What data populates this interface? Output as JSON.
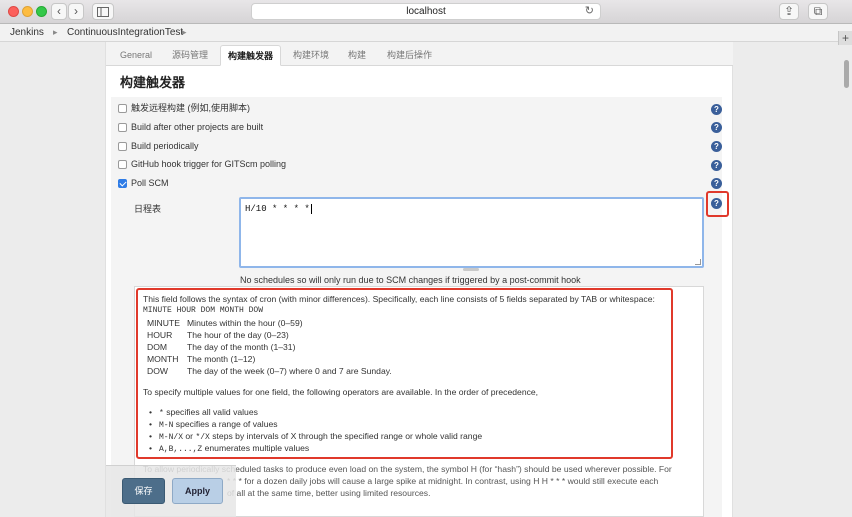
{
  "browser": {
    "url": "localhost",
    "back_glyph": "‹",
    "forward_glyph": "›",
    "reload_glyph": "↻",
    "share_glyph": "⇪",
    "tabs_glyph": "⧉",
    "newtab_glyph": "+"
  },
  "breadcrumb": {
    "items": [
      "Jenkins",
      "ContinuousIntegrationTest"
    ],
    "separator": "▸"
  },
  "tabs": [
    "General",
    "源码管理",
    "构建触发器",
    "构建环境",
    "构建",
    "构建后操作"
  ],
  "active_tab": "构建触发器",
  "section_title": "构建触发器",
  "triggers": [
    {
      "label": "触发远程构建 (例如,使用脚本)",
      "checked": false
    },
    {
      "label": "Build after other projects are built",
      "checked": false
    },
    {
      "label": "Build periodically",
      "checked": false
    },
    {
      "label": "GitHub hook trigger for GITScm polling",
      "checked": false
    },
    {
      "label": "Poll SCM",
      "checked": true
    }
  ],
  "help_icon_glyph": "?",
  "schedule": {
    "label": "日程表",
    "value": "H/10 * * * *",
    "note": "No schedules so will only run due to SCM changes if triggered by a post-commit hook"
  },
  "help": {
    "intro": "This field follows the syntax of cron (with minor differences). Specifically, each line consists of 5 fields separated by TAB or whitespace:",
    "format": "MINUTE HOUR DOM MONTH DOW",
    "fields": [
      {
        "key": "MINUTE",
        "desc": "Minutes within the hour (0–59)"
      },
      {
        "key": "HOUR",
        "desc": "The hour of the day (0–23)"
      },
      {
        "key": "DOM",
        "desc": "The day of the month (1–31)"
      },
      {
        "key": "MONTH",
        "desc": "The month (1–12)"
      },
      {
        "key": "DOW",
        "desc": "The day of the week (0–7) where 0 and 7 are Sunday."
      }
    ],
    "operators_intro": "To specify multiple values for one field, the following operators are available. In the order of precedence,",
    "operators": [
      {
        "code": "*",
        "text": " specifies all valid values"
      },
      {
        "code": "M-N",
        "text": " specifies a range of values"
      },
      {
        "code": "M-N/X",
        "text": " or ",
        "code2": "*/X",
        "text2": " steps by intervals of X through the specified range or whole valid range"
      },
      {
        "code": "A,B,...,Z",
        "text": " enumerates multiple values"
      }
    ],
    "para2_line1": "To allow periodically scheduled tasks to produce even load on the system, the symbol H (for “hash”) should be used wherever possible. For",
    "para2_line2": "* * * for a dozen daily jobs will cause a large spike at midnight. In contrast, using H H * * * would still execute each",
    "para2_line3": "of all at the same time, better using limited resources."
  },
  "buttons": {
    "save": "保存",
    "apply": "Apply"
  },
  "colors": {
    "highlight": "#e0392b",
    "help_icon": "#3a5f9a",
    "save_button": "#4d6e8a",
    "apply_button": "#b9cfe6"
  }
}
